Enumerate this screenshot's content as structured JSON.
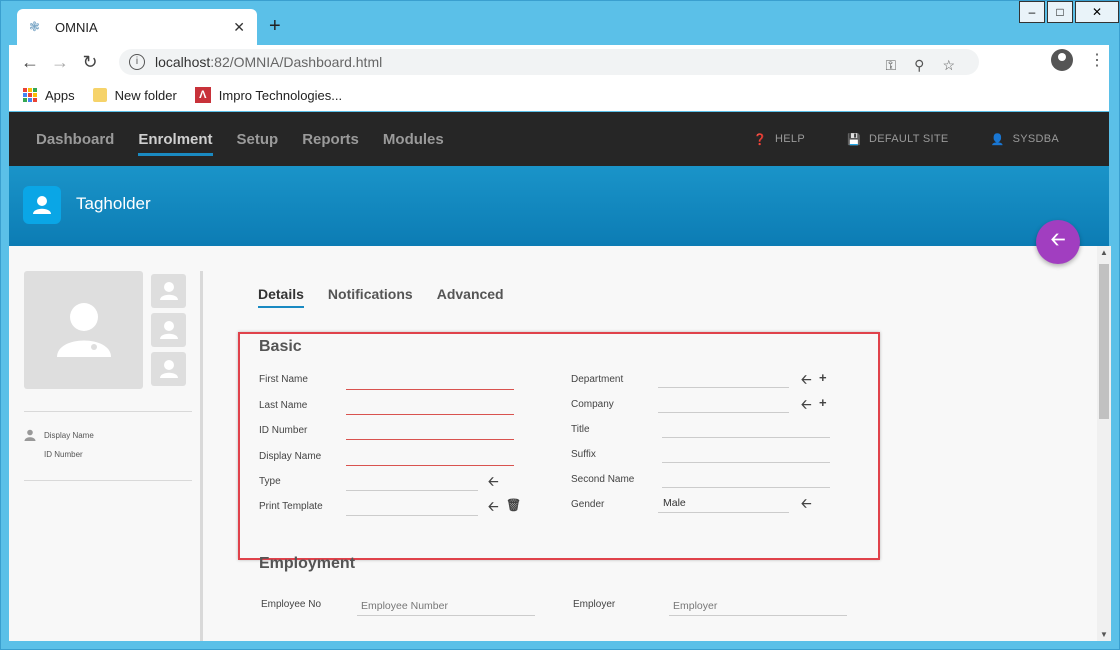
{
  "browser": {
    "tab_title": "OMNIA",
    "url_host": "localhost",
    "url_rest": ":82/OMNIA/Dashboard.html",
    "bookmarks": [
      "Apps",
      "New folder",
      "Impro Technologies..."
    ]
  },
  "nav": {
    "items": [
      "Dashboard",
      "Enrolment",
      "Setup",
      "Reports",
      "Modules"
    ],
    "active": "Enrolment",
    "help": "HELP",
    "site": "DEFAULT SITE",
    "user": "SYSDBA"
  },
  "banner": {
    "title": "Tagholder"
  },
  "left_panel": {
    "display_name": "Display Name",
    "id_number": "ID Number"
  },
  "tabs": [
    "Details",
    "Notifications",
    "Advanced"
  ],
  "basic": {
    "title": "Basic",
    "left_fields": [
      {
        "label": "First Name",
        "value": ""
      },
      {
        "label": "Last Name",
        "value": ""
      },
      {
        "label": "ID Number",
        "value": ""
      },
      {
        "label": "Display Name",
        "value": ""
      },
      {
        "label": "Type",
        "value": ""
      },
      {
        "label": "Print Template",
        "value": ""
      }
    ],
    "right_fields": [
      {
        "label": "Department",
        "value": ""
      },
      {
        "label": "Company",
        "value": ""
      },
      {
        "label": "Title",
        "value": ""
      },
      {
        "label": "Suffix",
        "value": ""
      },
      {
        "label": "Second Name",
        "value": ""
      },
      {
        "label": "Gender",
        "value": "Male"
      }
    ]
  },
  "employment": {
    "title": "Employment",
    "employee_no_label": "Employee No",
    "employee_no_placeholder": "Employee Number",
    "employer_label": "Employer",
    "employer_placeholder": "Employer"
  },
  "colors": {
    "nav_bg": "#262626",
    "banner": "#0c7cb4",
    "accent": "#1a8ac2",
    "fab": "#a13ec0",
    "highlight": "#e0424b",
    "required": "#d9534f"
  }
}
